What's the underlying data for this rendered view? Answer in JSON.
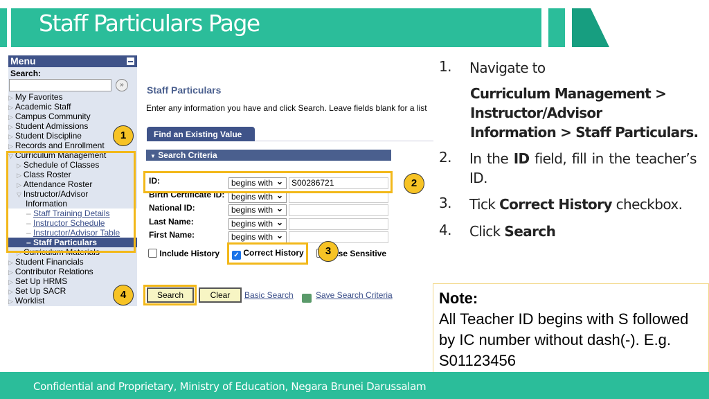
{
  "slide": {
    "title": "Staff Particulars Page",
    "footer": "Confidential and Proprietary, Ministry of Education, Negara Brunei Darussalam",
    "accent": "#2bbd9a"
  },
  "menu": {
    "title": "Menu",
    "search_label": "Search:",
    "items_top": [
      "My Favorites",
      "Academic Staff",
      "Campus Community",
      "Student Admissions",
      "Student Discipline",
      "Records and Enrollment"
    ],
    "curriculum": "Curriculum Management",
    "curriculum_sub": [
      "Schedule of Classes",
      "Class Roster",
      "Attendance Roster"
    ],
    "instructor": "Instructor/Advisor",
    "instructor2": "Information",
    "links": [
      "Staff Training Details",
      "Instructor Schedule",
      "Instructor/Advisor Table"
    ],
    "selected": "Staff Particulars",
    "curriculum_materials": "Curriculum Materials",
    "items_bottom": [
      "Student Financials",
      "Contributor Relations",
      "Set Up HRMS",
      "Set Up SACR",
      "Worklist"
    ]
  },
  "page": {
    "title": "Staff Particulars",
    "instructions": "Enter any information you have and click Search. Leave fields blank for a list",
    "tab": "Find an Existing Value",
    "section": "Search Criteria",
    "fields": [
      {
        "label": "ID:",
        "operator": "begins with",
        "value": "S00286721"
      },
      {
        "label": "Birth Certificate ID:",
        "operator": "begins with",
        "value": ""
      },
      {
        "label": "National ID:",
        "operator": "begins with",
        "value": ""
      },
      {
        "label": "Last Name:",
        "operator": "begins with",
        "value": ""
      },
      {
        "label": "First Name:",
        "operator": "begins with",
        "value": ""
      }
    ],
    "include_history": "Include History",
    "correct_history": "Correct History",
    "case_sensitive": "Case Sensitive",
    "search": "Search",
    "clear": "Clear",
    "basic_search": "Basic Search",
    "save_criteria": "Save Search Criteria"
  },
  "badges": [
    "1",
    "2",
    "3",
    "4"
  ],
  "steps": [
    {
      "num": "1.",
      "text": "Navigate to"
    },
    {
      "num": "2.",
      "pre": "In the ",
      "bold": "ID",
      "post": " field, fill in the teacher’s ID."
    },
    {
      "num": "3.",
      "pre": "Tick ",
      "bold": "Correct History",
      "post": " checkbox."
    },
    {
      "num": "4.",
      "pre": "Click ",
      "bold": "Search",
      "post": ""
    }
  ],
  "nav_path": [
    "Curriculum Management >",
    "Instructor/Advisor",
    "Information > Staff Particulars."
  ],
  "note": {
    "title": "Note:",
    "text": "All Teacher ID begins with S followed by IC number without dash(-). E.g. S01123456"
  }
}
